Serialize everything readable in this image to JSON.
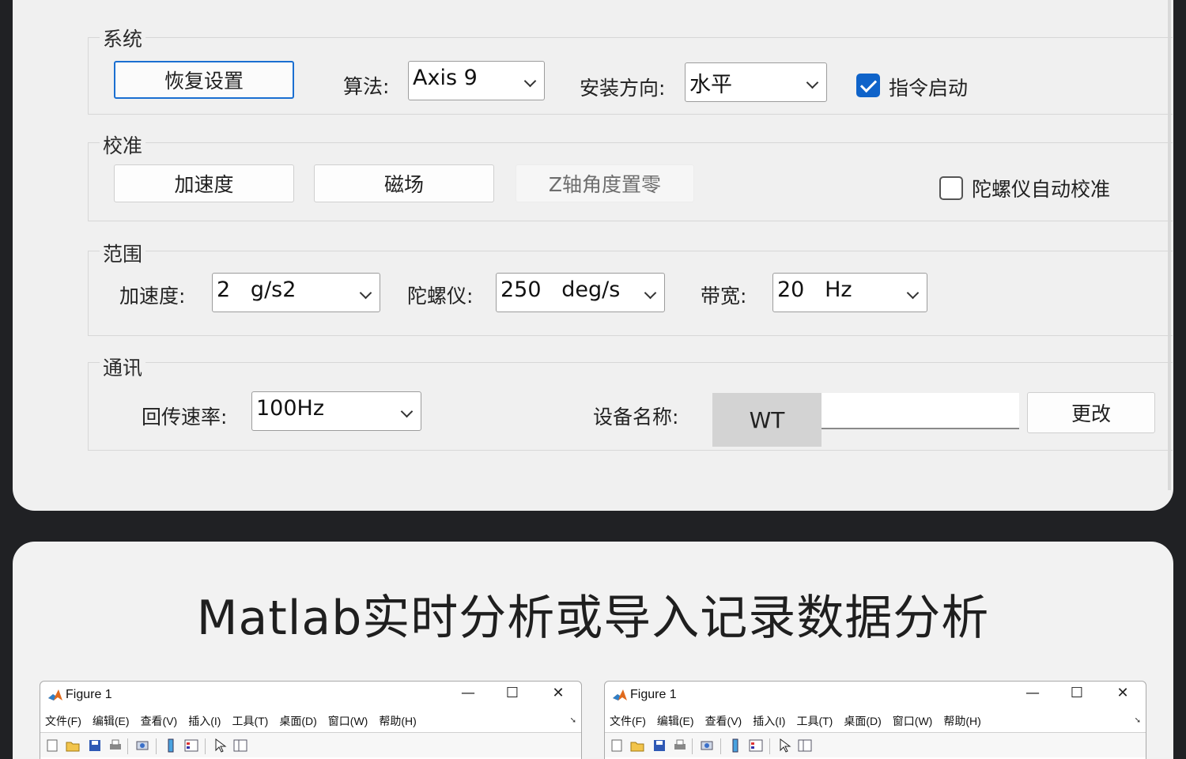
{
  "system": {
    "title": "系统",
    "restore_button": "恢复设置",
    "algorithm_label": "算法:",
    "algorithm_value": "Axis 9",
    "install_label": "安装方向:",
    "install_value": "水平",
    "command_start_label": "指令启动",
    "command_start_checked": true
  },
  "calibration": {
    "title": "校准",
    "accel_button": "加速度",
    "mag_button": "磁场",
    "z_zero_button": "Z轴角度置零",
    "gyro_auto_label": "陀螺仪自动校准",
    "gyro_auto_checked": false
  },
  "range": {
    "title": "范围",
    "accel_label": "加速度:",
    "accel_value": "2   g/s2",
    "gyro_label": "陀螺仪:",
    "gyro_value": "250   deg/s",
    "bandwidth_label": "带宽:",
    "bandwidth_value": "20   Hz"
  },
  "comm": {
    "title": "通讯",
    "rate_label": "回传速率:",
    "rate_value": "100Hz",
    "device_name_label": "设备名称:",
    "device_prefix": "WT",
    "device_name_value": "",
    "change_button": "更改"
  },
  "headline": "Matlab实时分析或导入记录数据分析",
  "figures": [
    {
      "title": "Figure 1",
      "controls": {
        "minimize": "—",
        "maximize": "☐",
        "close": "✕"
      },
      "menu": [
        "文件(F)",
        "编辑(E)",
        "查看(V)",
        "插入(I)",
        "工具(T)",
        "桌面(D)",
        "窗口(W)",
        "帮助(H)"
      ]
    },
    {
      "title": "Figure 1",
      "controls": {
        "minimize": "—",
        "maximize": "☐",
        "close": "✕"
      },
      "menu": [
        "文件(F)",
        "编辑(E)",
        "查看(V)",
        "插入(I)",
        "工具(T)",
        "桌面(D)",
        "窗口(W)",
        "帮助(H)"
      ]
    }
  ],
  "colors": {
    "accent": "#0f63c9",
    "panel_bg": "#f0f0f0",
    "page_bg": "#202124"
  },
  "toolbar_icons": [
    "new-file-icon",
    "open-folder-icon",
    "save-icon",
    "print-icon",
    "print-preview-icon",
    "colorbar-icon",
    "legend-icon",
    "pointer-icon",
    "property-editor-icon"
  ]
}
